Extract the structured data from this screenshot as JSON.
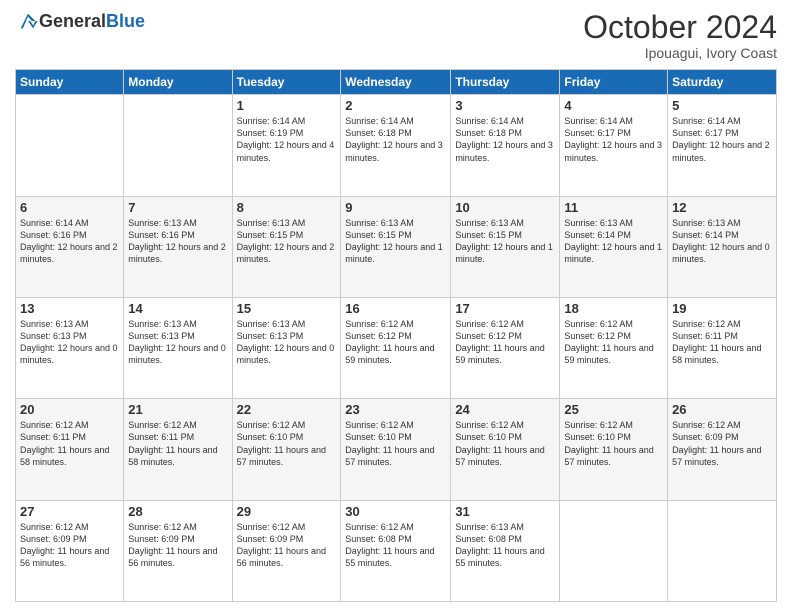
{
  "logo": {
    "general": "General",
    "blue": "Blue"
  },
  "header": {
    "month": "October 2024",
    "location": "Ipouagui, Ivory Coast"
  },
  "weekdays": [
    "Sunday",
    "Monday",
    "Tuesday",
    "Wednesday",
    "Thursday",
    "Friday",
    "Saturday"
  ],
  "weeks": [
    [
      {
        "day": "",
        "info": ""
      },
      {
        "day": "",
        "info": ""
      },
      {
        "day": "1",
        "info": "Sunrise: 6:14 AM\nSunset: 6:19 PM\nDaylight: 12 hours and 4 minutes."
      },
      {
        "day": "2",
        "info": "Sunrise: 6:14 AM\nSunset: 6:18 PM\nDaylight: 12 hours and 3 minutes."
      },
      {
        "day": "3",
        "info": "Sunrise: 6:14 AM\nSunset: 6:18 PM\nDaylight: 12 hours and 3 minutes."
      },
      {
        "day": "4",
        "info": "Sunrise: 6:14 AM\nSunset: 6:17 PM\nDaylight: 12 hours and 3 minutes."
      },
      {
        "day": "5",
        "info": "Sunrise: 6:14 AM\nSunset: 6:17 PM\nDaylight: 12 hours and 2 minutes."
      }
    ],
    [
      {
        "day": "6",
        "info": "Sunrise: 6:14 AM\nSunset: 6:16 PM\nDaylight: 12 hours and 2 minutes."
      },
      {
        "day": "7",
        "info": "Sunrise: 6:13 AM\nSunset: 6:16 PM\nDaylight: 12 hours and 2 minutes."
      },
      {
        "day": "8",
        "info": "Sunrise: 6:13 AM\nSunset: 6:15 PM\nDaylight: 12 hours and 2 minutes."
      },
      {
        "day": "9",
        "info": "Sunrise: 6:13 AM\nSunset: 6:15 PM\nDaylight: 12 hours and 1 minute."
      },
      {
        "day": "10",
        "info": "Sunrise: 6:13 AM\nSunset: 6:15 PM\nDaylight: 12 hours and 1 minute."
      },
      {
        "day": "11",
        "info": "Sunrise: 6:13 AM\nSunset: 6:14 PM\nDaylight: 12 hours and 1 minute."
      },
      {
        "day": "12",
        "info": "Sunrise: 6:13 AM\nSunset: 6:14 PM\nDaylight: 12 hours and 0 minutes."
      }
    ],
    [
      {
        "day": "13",
        "info": "Sunrise: 6:13 AM\nSunset: 6:13 PM\nDaylight: 12 hours and 0 minutes."
      },
      {
        "day": "14",
        "info": "Sunrise: 6:13 AM\nSunset: 6:13 PM\nDaylight: 12 hours and 0 minutes."
      },
      {
        "day": "15",
        "info": "Sunrise: 6:13 AM\nSunset: 6:13 PM\nDaylight: 12 hours and 0 minutes."
      },
      {
        "day": "16",
        "info": "Sunrise: 6:12 AM\nSunset: 6:12 PM\nDaylight: 11 hours and 59 minutes."
      },
      {
        "day": "17",
        "info": "Sunrise: 6:12 AM\nSunset: 6:12 PM\nDaylight: 11 hours and 59 minutes."
      },
      {
        "day": "18",
        "info": "Sunrise: 6:12 AM\nSunset: 6:12 PM\nDaylight: 11 hours and 59 minutes."
      },
      {
        "day": "19",
        "info": "Sunrise: 6:12 AM\nSunset: 6:11 PM\nDaylight: 11 hours and 58 minutes."
      }
    ],
    [
      {
        "day": "20",
        "info": "Sunrise: 6:12 AM\nSunset: 6:11 PM\nDaylight: 11 hours and 58 minutes."
      },
      {
        "day": "21",
        "info": "Sunrise: 6:12 AM\nSunset: 6:11 PM\nDaylight: 11 hours and 58 minutes."
      },
      {
        "day": "22",
        "info": "Sunrise: 6:12 AM\nSunset: 6:10 PM\nDaylight: 11 hours and 57 minutes."
      },
      {
        "day": "23",
        "info": "Sunrise: 6:12 AM\nSunset: 6:10 PM\nDaylight: 11 hours and 57 minutes."
      },
      {
        "day": "24",
        "info": "Sunrise: 6:12 AM\nSunset: 6:10 PM\nDaylight: 11 hours and 57 minutes."
      },
      {
        "day": "25",
        "info": "Sunrise: 6:12 AM\nSunset: 6:10 PM\nDaylight: 11 hours and 57 minutes."
      },
      {
        "day": "26",
        "info": "Sunrise: 6:12 AM\nSunset: 6:09 PM\nDaylight: 11 hours and 57 minutes."
      }
    ],
    [
      {
        "day": "27",
        "info": "Sunrise: 6:12 AM\nSunset: 6:09 PM\nDaylight: 11 hours and 56 minutes."
      },
      {
        "day": "28",
        "info": "Sunrise: 6:12 AM\nSunset: 6:09 PM\nDaylight: 11 hours and 56 minutes."
      },
      {
        "day": "29",
        "info": "Sunrise: 6:12 AM\nSunset: 6:09 PM\nDaylight: 11 hours and 56 minutes."
      },
      {
        "day": "30",
        "info": "Sunrise: 6:12 AM\nSunset: 6:08 PM\nDaylight: 11 hours and 55 minutes."
      },
      {
        "day": "31",
        "info": "Sunrise: 6:13 AM\nSunset: 6:08 PM\nDaylight: 11 hours and 55 minutes."
      },
      {
        "day": "",
        "info": ""
      },
      {
        "day": "",
        "info": ""
      }
    ]
  ],
  "shading": [
    false,
    true,
    false,
    true,
    false
  ]
}
